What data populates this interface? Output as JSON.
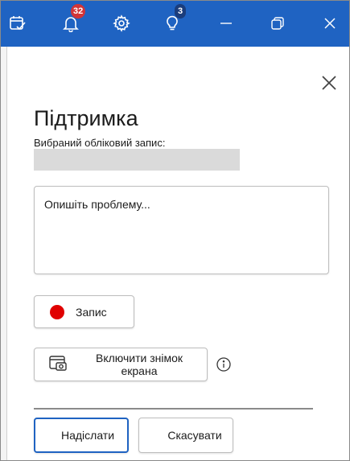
{
  "titlebar": {
    "notifications_count": "32",
    "tips_count": "3",
    "colors": {
      "background": "#1f63c2",
      "notification_badge": "#d13438",
      "tips_badge": "#1a3d7c"
    },
    "icons": [
      "calendar-check-icon",
      "bell-icon",
      "gear-icon",
      "lightbulb-icon",
      "minimize-icon",
      "restore-icon",
      "close-icon"
    ]
  },
  "panel": {
    "title": "Підтримка",
    "account_label": "Вибраний обліковий запис:",
    "account_value": "",
    "description_placeholder": "Опишіть проблему...",
    "record_label": "Запис",
    "screenshot_label": "Включити знімок екрана",
    "send_label": "Надіслати",
    "cancel_label": "Скасувати",
    "colors": {
      "record_dot": "#e00000",
      "primary_border": "#1f63c2"
    }
  }
}
